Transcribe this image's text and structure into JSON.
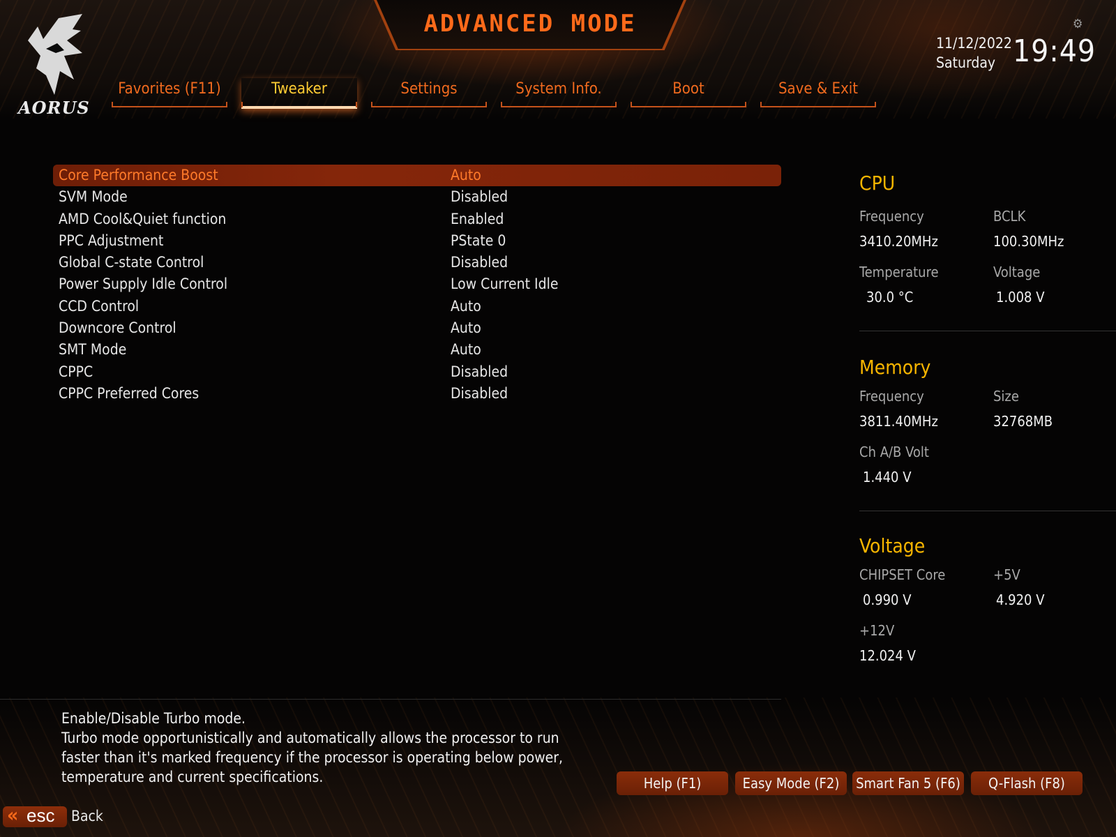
{
  "header": {
    "title": "ADVANCED MODE",
    "logo_text": "AORUS",
    "date": "11/12/2022",
    "day": "Saturday",
    "time": "19:49"
  },
  "tabs": [
    {
      "label": "Favorites (F11)",
      "active": false
    },
    {
      "label": "Tweaker",
      "active": true
    },
    {
      "label": "Settings",
      "active": false
    },
    {
      "label": "System Info.",
      "active": false
    },
    {
      "label": "Boot",
      "active": false
    },
    {
      "label": "Save & Exit",
      "active": false
    }
  ],
  "settings": [
    {
      "name": "Core Performance Boost",
      "value": "Auto"
    },
    {
      "name": "SVM Mode",
      "value": "Disabled"
    },
    {
      "name": "AMD Cool&Quiet function",
      "value": "Enabled"
    },
    {
      "name": "PPC Adjustment",
      "value": "PState 0"
    },
    {
      "name": "Global C-state Control",
      "value": "Disabled"
    },
    {
      "name": "Power Supply Idle Control",
      "value": "Low Current Idle"
    },
    {
      "name": "CCD Control",
      "value": "Auto"
    },
    {
      "name": "Downcore Control",
      "value": "Auto"
    },
    {
      "name": "SMT Mode",
      "value": "Auto"
    },
    {
      "name": "CPPC",
      "value": "Disabled"
    },
    {
      "name": "CPPC Preferred Cores",
      "value": "Disabled"
    }
  ],
  "cpu": {
    "title": "CPU",
    "frequency_label": "Frequency",
    "frequency": "3410.20MHz",
    "bclk_label": "BCLK",
    "bclk": "100.30MHz",
    "temperature_label": "Temperature",
    "temperature": "30.0 °C",
    "voltage_label": "Voltage",
    "voltage": "1.008 V"
  },
  "memory": {
    "title": "Memory",
    "frequency_label": "Frequency",
    "frequency": "3811.40MHz",
    "size_label": "Size",
    "size": "32768MB",
    "volt_label": "Ch A/B Volt",
    "volt": "1.440 V"
  },
  "voltage": {
    "title": "Voltage",
    "chipset_label": "CHIPSET Core",
    "chipset": "0.990 V",
    "p5v_label": "+5V",
    "p5v": "4.920 V",
    "p12v_label": "+12V",
    "p12v": "12.024 V"
  },
  "help": {
    "line1": "Enable/Disable Turbo mode.",
    "line2": "Turbo mode opportunistically and automatically allows the processor to run",
    "line3": "faster than it's marked frequency if the processor is operating below power,",
    "line4": "temperature and current specifications."
  },
  "footer": {
    "help_btn": "Help (F1)",
    "easy_btn": "Easy Mode (F2)",
    "fan_btn": "Smart Fan 5 (F6)",
    "qflash_btn": "Q-Flash (F8)",
    "esc_label": "esc",
    "back_label": "Back"
  },
  "colors": {
    "accent": "#f06a1e",
    "active_tab": "#ffcc33",
    "section_title": "#f7b500",
    "selected_row": "#85260a"
  }
}
